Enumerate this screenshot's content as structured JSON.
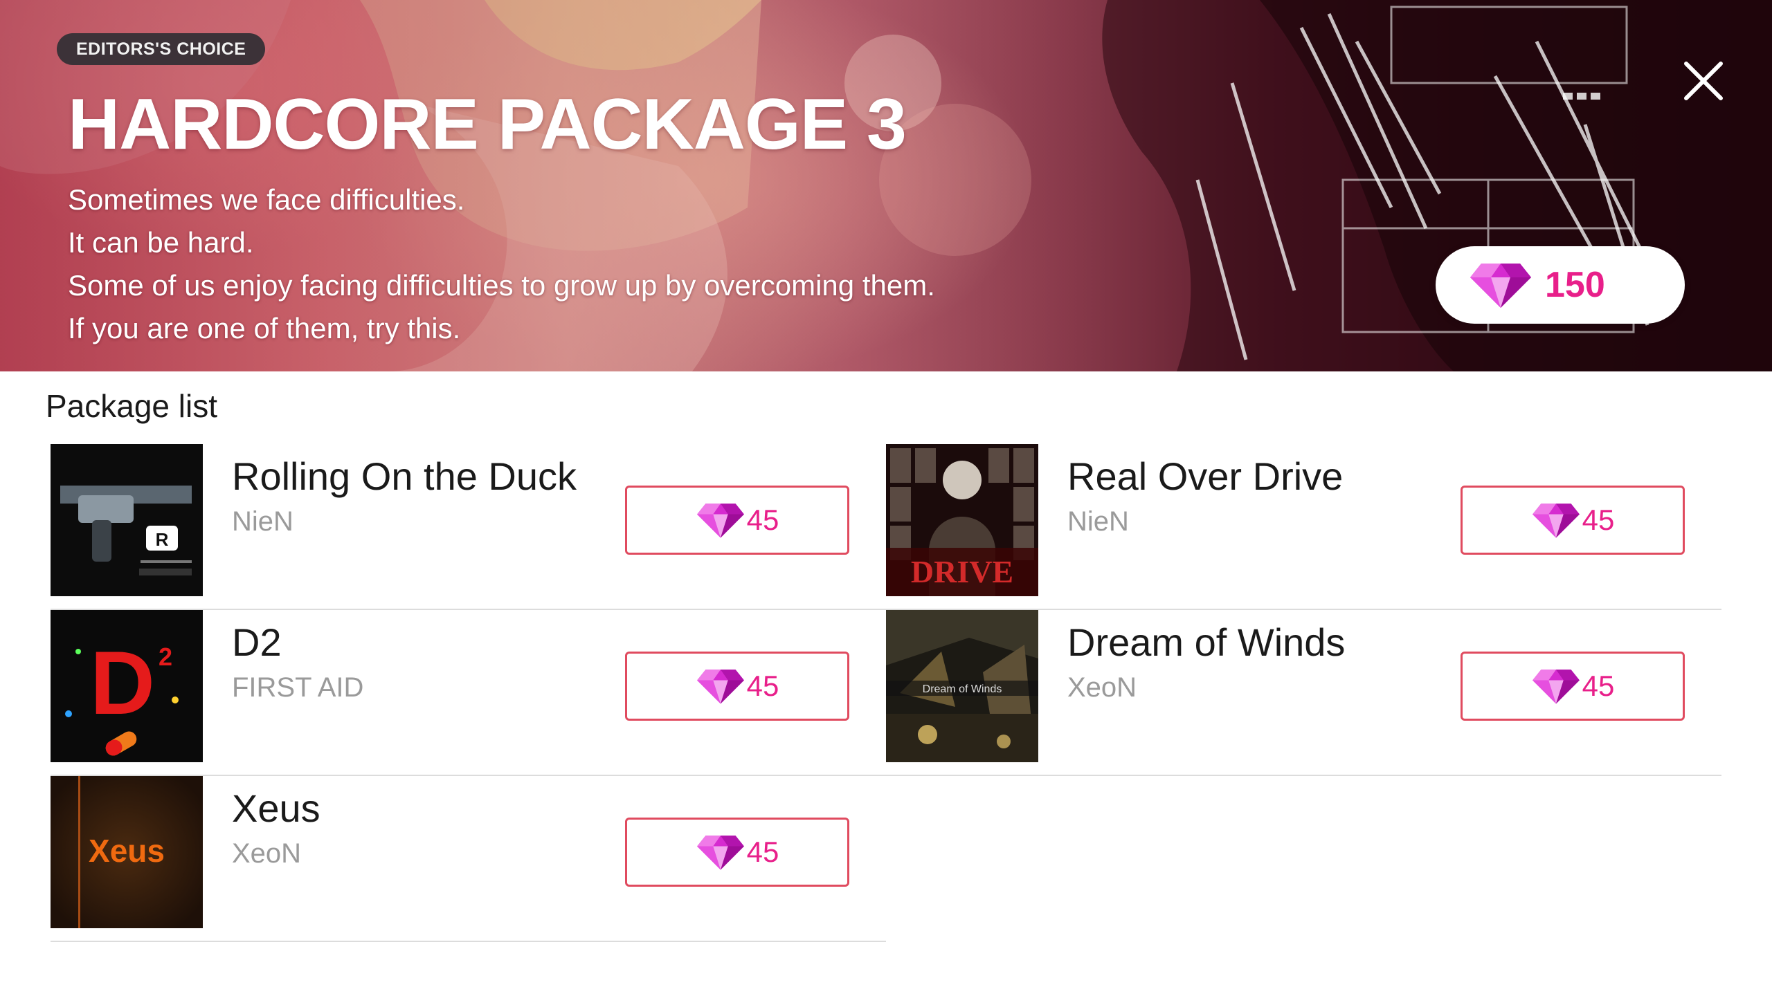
{
  "hero": {
    "badge": "EDITORS'S CHOICE",
    "title": "HARDCORE PACKAGE 3",
    "description": [
      "Sometimes we face difficulties.",
      "It can be hard.",
      "Some of us enjoy facing difficulties to grow up by overcoming them.",
      "If you are one of them, try this."
    ],
    "price": "150",
    "close_icon": "close-icon",
    "currency_icon": "gem-icon"
  },
  "package_list": {
    "title": "Package list",
    "items": [
      {
        "name": "Rolling On the Duck",
        "artist": "NieN",
        "price": "45",
        "thumb": "rolling-on-the-duck-cover"
      },
      {
        "name": "Real Over Drive",
        "artist": "NieN",
        "price": "45",
        "thumb": "real-over-drive-cover"
      },
      {
        "name": "D2",
        "artist": "FIRST AID",
        "price": "45",
        "thumb": "d2-cover"
      },
      {
        "name": "Dream of Winds",
        "artist": "XeoN",
        "price": "45",
        "thumb": "dream-of-winds-cover"
      },
      {
        "name": "Xeus",
        "artist": "XeoN",
        "price": "45",
        "thumb": "xeus-cover"
      }
    ]
  },
  "cover_text": {
    "d2_letter": "D",
    "d2_superscript": "2",
    "xeus_logo": "Xeus",
    "real_over_drive_logo": "DRIVE",
    "dream_of_winds_logo": "Dream of Winds"
  },
  "colors": {
    "accent": "#e81f8a",
    "button_border": "#e04b5f",
    "badge_bg": "#3c3238",
    "secondary_text": "#9a9a9a"
  }
}
